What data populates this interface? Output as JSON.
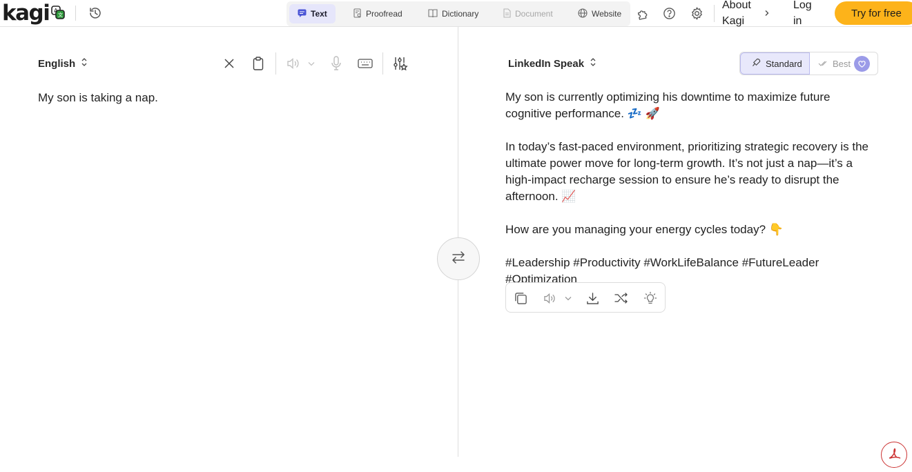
{
  "header": {
    "logo_text": "kagi",
    "modes": [
      {
        "label": "Text",
        "icon": "chat-bubble-icon",
        "state": "active"
      },
      {
        "label": "Proofread",
        "icon": "proofread-icon",
        "state": "normal"
      },
      {
        "label": "Dictionary",
        "icon": "book-icon",
        "state": "normal"
      },
      {
        "label": "Document",
        "icon": "document-icon",
        "state": "disabled"
      },
      {
        "label": "Website",
        "icon": "globe-icon",
        "state": "normal"
      }
    ],
    "about_label": "About\nKagi",
    "login_label": "Log\nin",
    "cta_label": "Try for free"
  },
  "source": {
    "language": "English",
    "text": "My son is taking a nap."
  },
  "target": {
    "language": "LinkedIn Speak",
    "quality_options": [
      "Standard",
      "Best"
    ],
    "quality_selected": "Standard",
    "paragraphs": [
      "My son is currently optimizing his downtime to maximize future cognitive performance. 💤 🚀",
      "In today’s fast-paced environment, prioritizing strategic recovery is the ultimate power move for long-term growth. It’s not just a nap—it’s a high-impact recharge session to ensure he’s ready to disrupt the afternoon. 📈",
      "How are you managing your energy cycles today? 👇",
      "#Leadership #Productivity #WorkLifeBalance #FutureLeader #Optimization"
    ]
  },
  "colors": {
    "accent": "#fdb31a",
    "active_mode_bg": "#e6e6fb",
    "quality_badge": "#9b9be8"
  }
}
